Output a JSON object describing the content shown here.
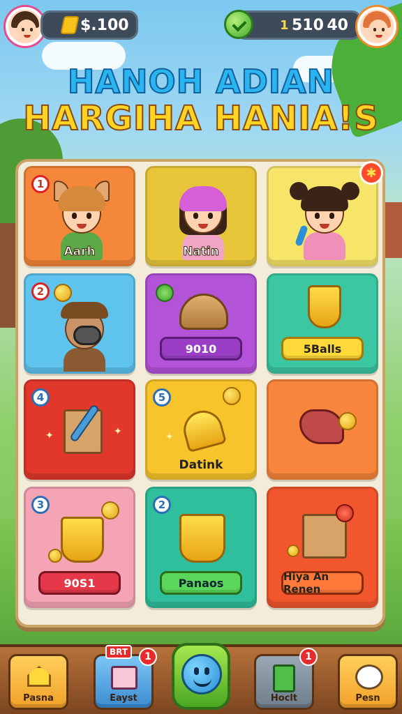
{
  "header": {
    "coins": "$.100",
    "gem_count": "1",
    "stat_a": "510",
    "stat_b": "40"
  },
  "title": {
    "line1": "HANOH ADIAN",
    "line2": "HARGIHA HANIA!S"
  },
  "tiles": [
    {
      "badge": "1",
      "label": "Aarh"
    },
    {
      "label": "Natin"
    },
    {
      "corner": "✱"
    },
    {
      "badge": "2"
    },
    {
      "button": "9010"
    },
    {
      "button": "5Balls"
    },
    {
      "badge": "4"
    },
    {
      "badge": "5",
      "label": "Datink"
    },
    {},
    {
      "badge": "3",
      "button": "90S1"
    },
    {
      "badge": "2",
      "button": "Panaos"
    },
    {
      "button": "Hiya An Renen"
    }
  ],
  "nav": {
    "items": [
      {
        "label": "Pasna"
      },
      {
        "label": "Eayst",
        "badge": "1",
        "tag": "BRT"
      },
      {
        "label": ""
      },
      {
        "label": "Hoclt",
        "badge": "1"
      },
      {
        "label": "Pesn"
      }
    ]
  },
  "colors": {
    "tile_1": "#f4873a",
    "tile_2": "#e8c63a",
    "tile_3": "#f7e56a",
    "tile_4": "#5ec4ee",
    "tile_5": "#b353d8",
    "tile_6": "#3bc7a2",
    "tile_7": "#e2382c",
    "tile_8": "#f7c42b",
    "tile_9": "#f7853b",
    "tile_10": "#f5a4b6",
    "tile_11": "#2fbf9c",
    "tile_12": "#f2562c"
  }
}
